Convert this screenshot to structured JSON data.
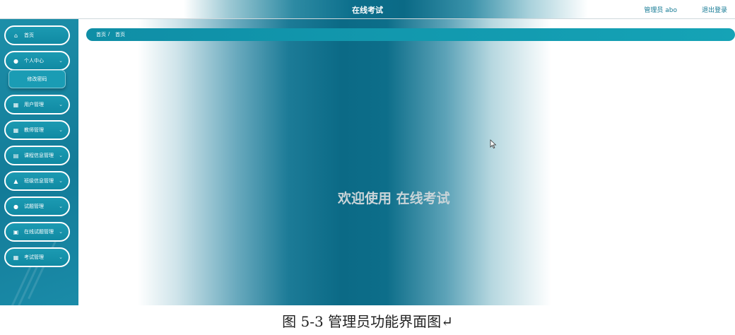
{
  "header": {
    "title": "在线考试",
    "user": "管理员 abo",
    "logout": "退出登录"
  },
  "sidebar": {
    "items": [
      {
        "label": "首页",
        "icon": "home-icon",
        "chevron": ""
      },
      {
        "label": "个人中心",
        "icon": "person-icon",
        "chevron": "⌄"
      },
      {
        "label": "用户管理",
        "icon": "grid-icon",
        "chevron": "⌄"
      },
      {
        "label": "教师管理",
        "icon": "grid-icon",
        "chevron": "⌄"
      },
      {
        "label": "课程信息管理",
        "icon": "clipboard-icon",
        "chevron": "⌄"
      },
      {
        "label": "班级信息管理",
        "icon": "thumb-icon",
        "chevron": "⌄"
      },
      {
        "label": "试题管理",
        "icon": "location-pin-icon",
        "chevron": "⌄"
      },
      {
        "label": "在线试题管理",
        "icon": "calendar-icon",
        "chevron": "⌄"
      },
      {
        "label": "考试管理",
        "icon": "grid-icon",
        "chevron": "⌄"
      }
    ],
    "submenu": {
      "label": "修改密码"
    }
  },
  "breadcrumb": {
    "home": "首页",
    "separator": "/",
    "current": "首页"
  },
  "main": {
    "welcome": "欢迎使用 在线考试"
  },
  "caption": "图 5-3 管理员功能界面图↵",
  "colors": {
    "accent": "#1392ab",
    "header_dark": "#0b6a86",
    "link": "#147a94",
    "welcome_text": "#c9d4d8"
  }
}
